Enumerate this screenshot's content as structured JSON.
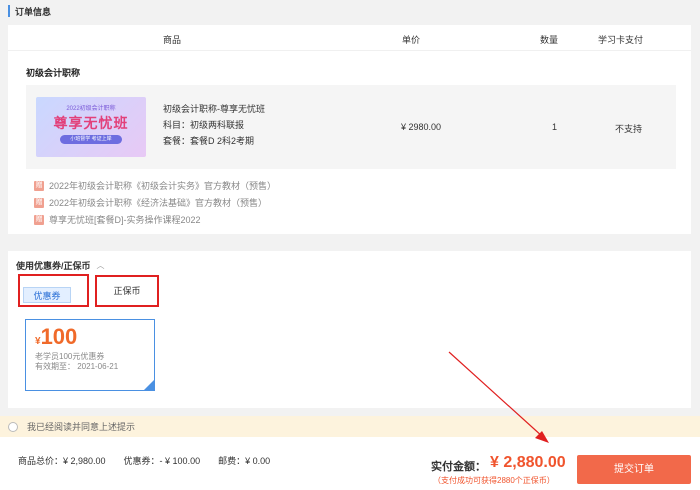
{
  "section_title": "订单信息",
  "table_headers": {
    "product": "商品",
    "price": "单价",
    "qty": "数量",
    "card_pay": "学习卡支付"
  },
  "course": {
    "category": "初级会计职称",
    "thumb_top": "2022初级会计职称",
    "thumb_main": "尊享无忧班",
    "thumb_tag": "小班督学 考证上岸",
    "name": "初级会计职称-尊享无忧班",
    "subject": "科目：初级两科联报",
    "package": "套餐：套餐D 2科2考期",
    "price": "¥ 2980.00",
    "qty": "1",
    "card_pay": "不支持"
  },
  "gifts": [
    "2022年初级会计职称《初级会计实务》官方教材（预售）",
    "2022年初级会计职称《经济法基础》官方教材（预售）",
    "尊享无忧班[套餐D]-实务操作课程2022"
  ],
  "coupon_section": {
    "title": "使用优惠券/正保币",
    "tab_coupon": "优惠券",
    "tab_coin": "正保币",
    "ticket": {
      "yen": "¥",
      "amount": "100",
      "desc": "老学员100元优惠券",
      "expiry": "有效期至：  2021-06-21"
    }
  },
  "agree_text": "我已经阅读并同意上述提示",
  "summary": {
    "goods_total": "商品总价：¥ 2,980.00",
    "coupon": "优惠券：- ¥ 100.00",
    "shipping": "邮费：¥ 0.00"
  },
  "pay": {
    "label": "实付金额：",
    "amount": "¥ 2,880.00",
    "note": "（支付成功可获得2880个正保币）",
    "submit": "提交订单"
  },
  "colors": {
    "accent": "#f2694a",
    "price": "#f0542d",
    "annotation": "#e02020"
  }
}
